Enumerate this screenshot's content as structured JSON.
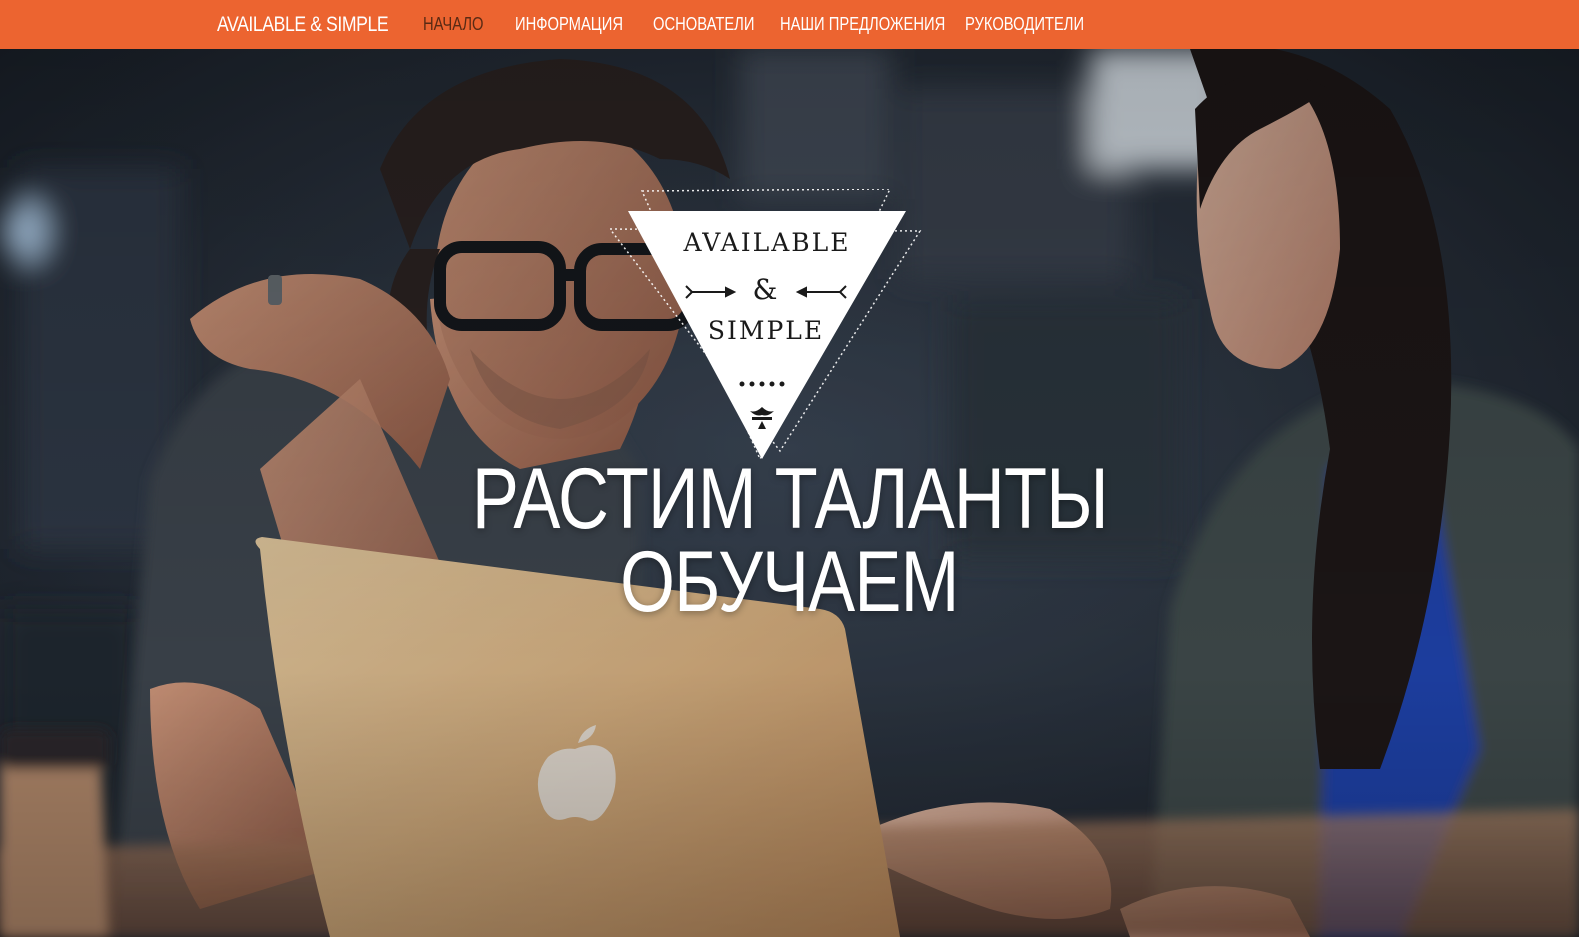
{
  "navbar": {
    "brand": "AVAILABLE & SIMPLE",
    "items": [
      {
        "label": "НАЧАЛО",
        "active": true
      },
      {
        "label": "ИНФОРМАЦИЯ",
        "active": false
      },
      {
        "label": "ОСНОВАТЕЛИ",
        "active": false
      },
      {
        "label": "НАШИ ПРЕДЛОЖЕНИЯ",
        "active": false
      },
      {
        "label": "РУКОВОДИТЕЛИ",
        "active": false
      }
    ]
  },
  "logo": {
    "line1": "AVAILABLE",
    "line2": "&",
    "line3": "SIMPLE"
  },
  "hero": {
    "headline_line1": "РАСТИМ ТАЛАНТЫ",
    "headline_line2": "ОБУЧАЕМ"
  },
  "colors": {
    "navbar": "#ec6430",
    "active_nav": "#5a2a14",
    "text": "#ffffff"
  }
}
